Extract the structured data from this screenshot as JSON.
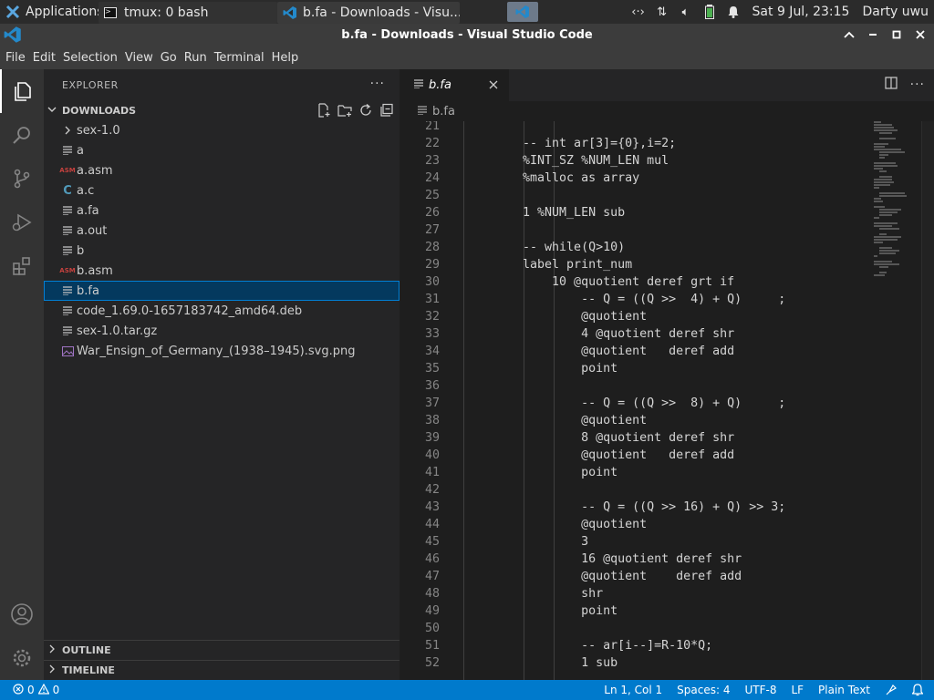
{
  "system_panel": {
    "app_menu_label": "Applications",
    "tasks": [
      {
        "label": "tmux: 0 bash"
      },
      {
        "label": "b.fa - Downloads - Visu..."
      }
    ],
    "clock": "Sat  9 Jul, 23:15",
    "user": "Darty uwu"
  },
  "window": {
    "title": "b.fa - Downloads - Visual Studio Code"
  },
  "menu": {
    "items": [
      "File",
      "Edit",
      "Selection",
      "View",
      "Go",
      "Run",
      "Terminal",
      "Help"
    ]
  },
  "sidebar": {
    "title": "EXPLORER",
    "more": "···",
    "section_title": "DOWNLOADS",
    "files": [
      {
        "name": "sex-1.0",
        "icon": "chevron-right-icon"
      },
      {
        "name": "a",
        "icon": "text-file-icon"
      },
      {
        "name": "a.asm",
        "icon": "asm-file-icon"
      },
      {
        "name": "a.c",
        "icon": "c-file-icon"
      },
      {
        "name": "a.fa",
        "icon": "text-file-icon"
      },
      {
        "name": "a.out",
        "icon": "text-file-icon"
      },
      {
        "name": "b",
        "icon": "text-file-icon"
      },
      {
        "name": "b.asm",
        "icon": "asm-file-icon"
      },
      {
        "name": "b.fa",
        "icon": "text-file-icon",
        "selected": true
      },
      {
        "name": "code_1.69.0-1657183742_amd64.deb",
        "icon": "text-file-icon"
      },
      {
        "name": "sex-1.0.tar.gz",
        "icon": "text-file-icon"
      },
      {
        "name": "War_Ensign_of_Germany_(1938–1945).svg.png",
        "icon": "image-file-icon"
      }
    ],
    "outline_label": "OUTLINE",
    "timeline_label": "TIMELINE"
  },
  "editor": {
    "tab_label": "b.fa",
    "breadcrumb": "b.fa",
    "lines": [
      {
        "n": "21",
        "text": ""
      },
      {
        "n": "22",
        "text": "    -- int ar[3]={0},i=2;"
      },
      {
        "n": "23",
        "text": "    %INT_SZ %NUM_LEN mul"
      },
      {
        "n": "24",
        "text": "    %malloc as array"
      },
      {
        "n": "25",
        "text": ""
      },
      {
        "n": "26",
        "text": "    1 %NUM_LEN sub"
      },
      {
        "n": "27",
        "text": ""
      },
      {
        "n": "28",
        "text": "    -- while(Q>10)"
      },
      {
        "n": "29",
        "text": "    label print_num"
      },
      {
        "n": "30",
        "text": "        10 @quotient deref grt if"
      },
      {
        "n": "31",
        "text": "            -- Q = ((Q >>  4) + Q)     ;"
      },
      {
        "n": "32",
        "text": "            @quotient"
      },
      {
        "n": "33",
        "text": "            4 @quotient deref shr"
      },
      {
        "n": "34",
        "text": "            @quotient   deref add"
      },
      {
        "n": "35",
        "text": "            point"
      },
      {
        "n": "36",
        "text": ""
      },
      {
        "n": "37",
        "text": "            -- Q = ((Q >>  8) + Q)     ;"
      },
      {
        "n": "38",
        "text": "            @quotient"
      },
      {
        "n": "39",
        "text": "            8 @quotient deref shr"
      },
      {
        "n": "40",
        "text": "            @quotient   deref add"
      },
      {
        "n": "41",
        "text": "            point"
      },
      {
        "n": "42",
        "text": ""
      },
      {
        "n": "43",
        "text": "            -- Q = ((Q >> 16) + Q) >> 3;"
      },
      {
        "n": "44",
        "text": "            @quotient"
      },
      {
        "n": "45",
        "text": "            3"
      },
      {
        "n": "46",
        "text": "            16 @quotient deref shr"
      },
      {
        "n": "47",
        "text": "            @quotient    deref add"
      },
      {
        "n": "48",
        "text": "            shr"
      },
      {
        "n": "49",
        "text": "            point"
      },
      {
        "n": "50",
        "text": ""
      },
      {
        "n": "51",
        "text": "            -- ar[i--]=R-10*Q;"
      },
      {
        "n": "52",
        "text": "            1 sub"
      }
    ]
  },
  "status": {
    "errors": "0",
    "warnings": "0",
    "position": "Ln 1, Col 1",
    "spaces": "Spaces: 4",
    "encoding": "UTF-8",
    "eol": "LF",
    "language": "Plain Text"
  },
  "colors": {
    "status_bar": "#007acc",
    "selection": "#04395e",
    "accent_border": "#007fd4"
  }
}
